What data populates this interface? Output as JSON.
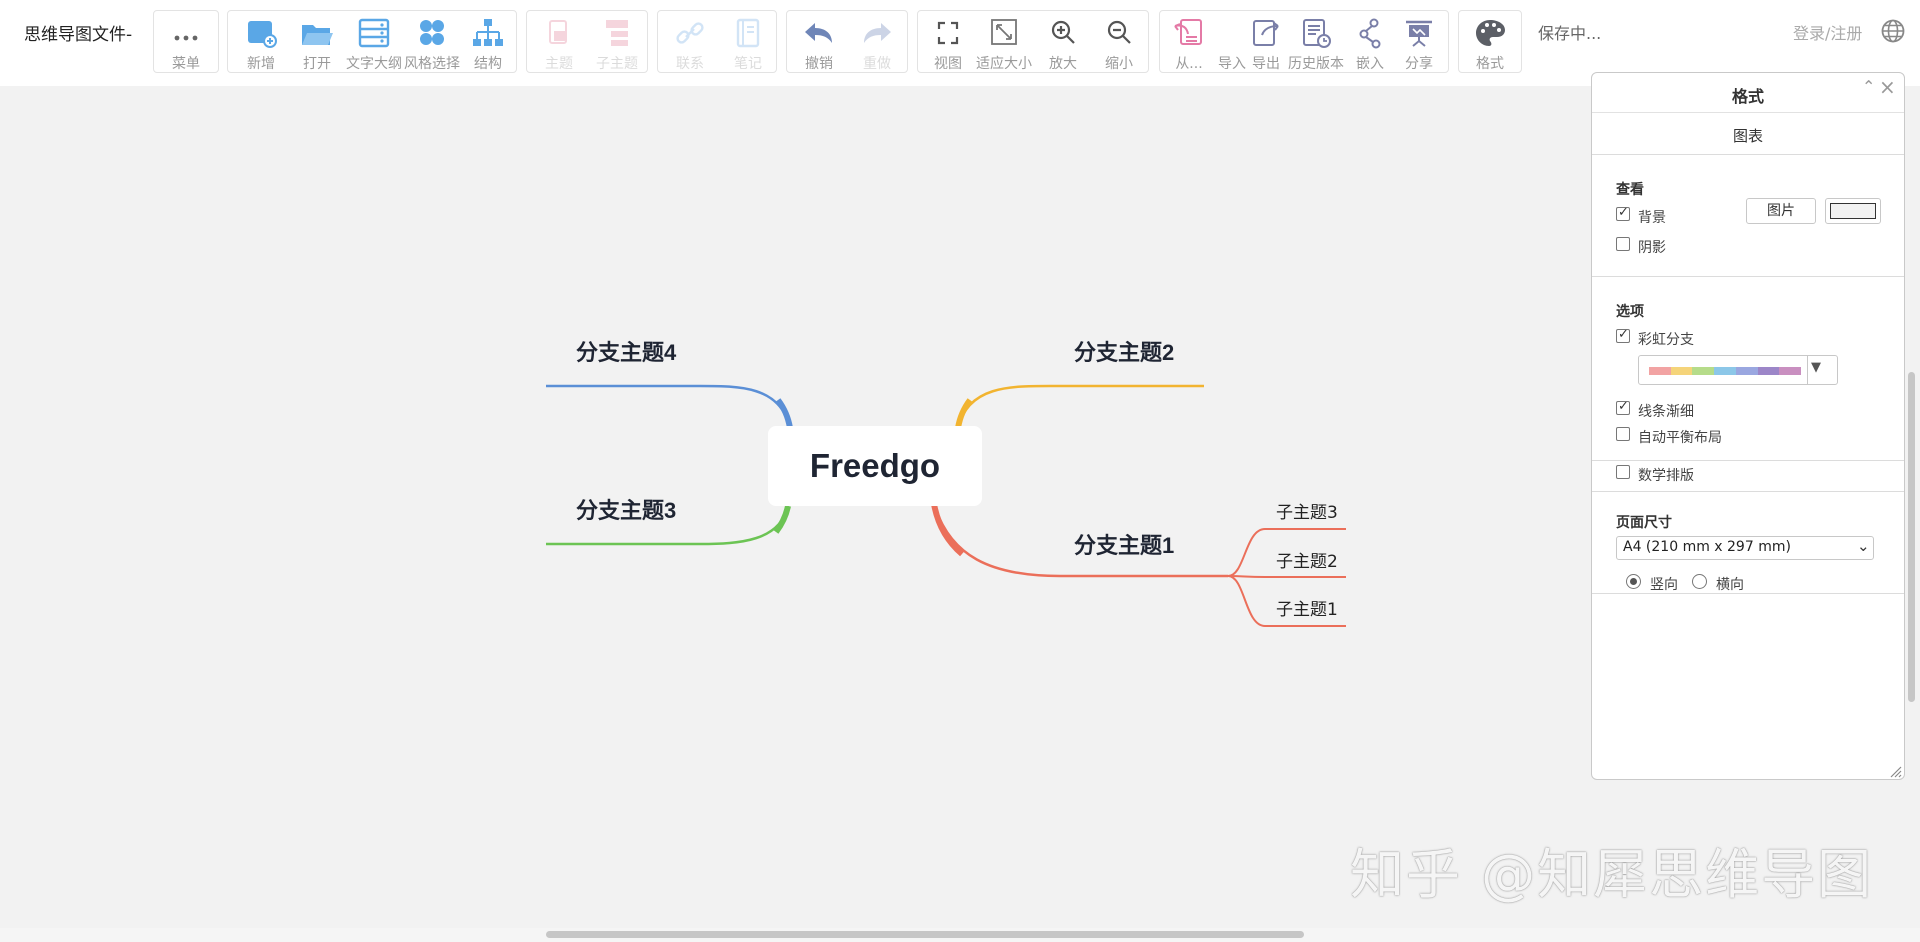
{
  "app": {
    "doc_title": "思维导图文件-",
    "save_status": "保存中...",
    "login_label": "登录/注册"
  },
  "toolbar": {
    "menu": {
      "label": "菜单",
      "icon": "more-dots-icon"
    },
    "new": {
      "label": "新增",
      "icon": "new-file-icon"
    },
    "open": {
      "label": "打开",
      "icon": "folder-open-icon"
    },
    "outline": {
      "label": "文字大纲",
      "icon": "outline-icon"
    },
    "style": {
      "label": "风格选择",
      "icon": "style-icon"
    },
    "structure": {
      "label": "结构",
      "icon": "structure-icon"
    },
    "topic": {
      "label": "主题",
      "icon": "topic-icon"
    },
    "subtopic": {
      "label": "子主题",
      "icon": "subtopic-icon"
    },
    "link": {
      "label": "联系",
      "icon": "link-icon"
    },
    "note": {
      "label": "笔记",
      "icon": "note-icon"
    },
    "undo": {
      "label": "撤销",
      "icon": "undo-icon"
    },
    "redo": {
      "label": "重做",
      "icon": "redo-icon"
    },
    "view": {
      "label": "视图",
      "icon": "fullscreen-icon"
    },
    "fit": {
      "label": "适应大小",
      "icon": "fit-icon"
    },
    "zoom_in": {
      "label": "放大",
      "icon": "zoom-in-icon"
    },
    "zoom_out": {
      "label": "缩小",
      "icon": "zoom-out-icon"
    },
    "from": {
      "label": "从...",
      "icon": "import-from-icon"
    },
    "import": {
      "label": "导入",
      "icon": "import-icon"
    },
    "export": {
      "label": "导出",
      "icon": "export-icon"
    },
    "history": {
      "label": "历史版本",
      "icon": "history-icon"
    },
    "embed": {
      "label": "嵌入",
      "icon": "embed-icon"
    },
    "share": {
      "label": "分享",
      "icon": "share-icon"
    },
    "format": {
      "label": "格式",
      "icon": "palette-icon"
    }
  },
  "mindmap": {
    "root": "Freedgo",
    "branches": [
      {
        "label": "分支主题1",
        "color": "#eb6f5a",
        "children": [
          "子主题3",
          "子主题2",
          "子主题1"
        ]
      },
      {
        "label": "分支主题2",
        "color": "#f2b430"
      },
      {
        "label": "分支主题3",
        "color": "#6cc454"
      },
      {
        "label": "分支主题4",
        "color": "#5b8fd6"
      }
    ]
  },
  "panel": {
    "title": "格式",
    "tab": "图表",
    "view_section": {
      "title": "查看",
      "background": {
        "label": "背景",
        "checked": true
      },
      "image_button": "图片",
      "shadow": {
        "label": "阴影",
        "checked": false
      }
    },
    "options_section": {
      "title": "选项",
      "rainbow": {
        "label": "彩虹分支",
        "checked": true
      },
      "rainbow_colors": [
        "#f2a3a3",
        "#f5d47a",
        "#b6dc8a",
        "#8cc7e8",
        "#9aa7e0",
        "#9c86c8",
        "#c98fc0"
      ],
      "taper": {
        "label": "线条渐细",
        "checked": true
      },
      "auto_balance": {
        "label": "自动平衡布局",
        "checked": false
      },
      "math": {
        "label": "数学排版",
        "checked": false
      }
    },
    "page_section": {
      "title": "页面尺寸",
      "size_value": "A4 (210 mm x 297 mm)",
      "portrait": {
        "label": "竖向",
        "selected": true
      },
      "landscape": {
        "label": "横向",
        "selected": false
      }
    }
  },
  "watermark": "知乎 @知犀思维导图"
}
